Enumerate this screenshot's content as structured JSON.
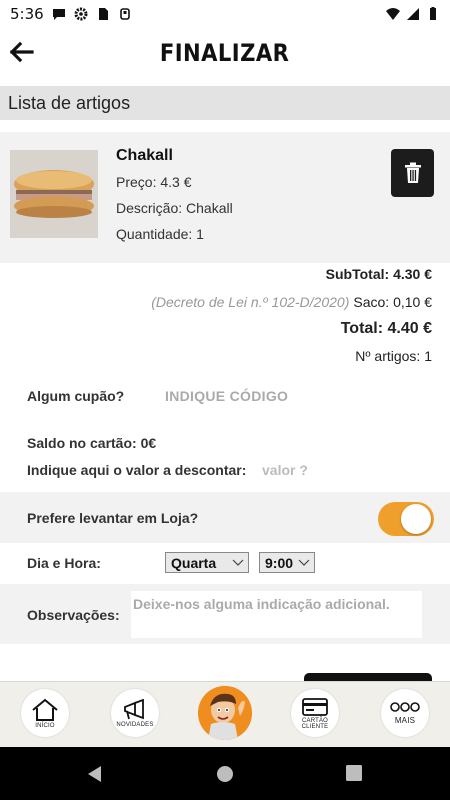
{
  "status_bar": {
    "time": "5:36"
  },
  "header": {
    "title": "FINALIZAR"
  },
  "section": {
    "title": "Lista de artigos"
  },
  "item": {
    "name": "Chakall",
    "price": "Preço: 4.3 €",
    "description": "Descrição: Chakall",
    "quantity": "Quantidade: 1"
  },
  "totals": {
    "subtotal": "SubTotal: 4.30 €",
    "decreto": "(Decreto de Lei n.º 102-D/2020)",
    "saco": "Saco: 0,10 €",
    "total": "Total: 4.40 €",
    "n_artigos": "Nº artigos: 1"
  },
  "form": {
    "cupao_label": "Algum cupão?",
    "cupao_placeholder": "INDIQUE CÓDIGO",
    "saldo_label": "Saldo no cartão: 0€",
    "descontar_label": "Indique aqui o valor a descontar:",
    "valor_placeholder": "valor ?",
    "levantar_label": "Prefere levantar em Loja?",
    "levantar_on": true,
    "dia_hora_label": "Dia e Hora:",
    "dia_value": "Quarta",
    "hora_value": "9:00",
    "obs_label": "Observações:",
    "obs_placeholder": "Deixe-nos alguma indicação adicional."
  },
  "bottom_nav": {
    "items": [
      {
        "label": "INÍCIO",
        "icon": "home-icon"
      },
      {
        "label": "NOVIDADES",
        "icon": "megaphone-icon"
      },
      {
        "label": "",
        "icon": "mascot-icon"
      },
      {
        "label": "CARTÃO CLIENTE",
        "icon": "card-icon"
      },
      {
        "label": "MAIS",
        "icon": "more-icon"
      }
    ]
  },
  "colors": {
    "accent": "#ef9f2c",
    "section_bg": "#e3e3e3",
    "card_bg": "#f2f2f2"
  }
}
